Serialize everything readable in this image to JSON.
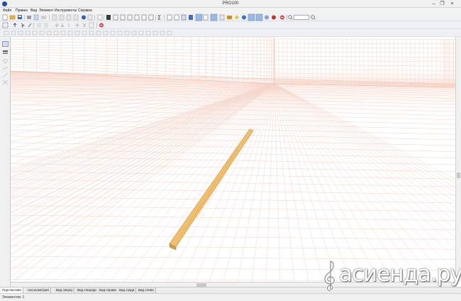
{
  "window": {
    "title": "PRO100"
  },
  "menu": [
    "Файл",
    "Правка",
    "Вид",
    "Элемент",
    "Инструменты",
    "Справка"
  ],
  "view_tabs": [
    {
      "label": "Перспектива",
      "active": true
    },
    {
      "label": "Аксонометрия",
      "active": false
    },
    {
      "label": "Вид сверху",
      "active": false
    },
    {
      "label": "Вид спереди",
      "active": false
    },
    {
      "label": "Вид справа",
      "active": false
    },
    {
      "label": "Вид сзади",
      "active": false
    },
    {
      "label": "Вид слева",
      "active": false
    }
  ],
  "status": {
    "elements": "Элементов: 1"
  },
  "watermark": {
    "text": "асиенда.ру"
  },
  "colors": {
    "grid": "#f2d2c6",
    "board": "#f0c27a",
    "toolbar": "#eef0f3",
    "active_button": "#9fb8e0"
  },
  "icons": {
    "new": "new-file-icon",
    "open": "open-folder-icon",
    "save": "save-icon",
    "undo": "undo-icon",
    "redo": "redo-icon",
    "sum": "sigma-icon",
    "zoom": "magnifier-icon",
    "stop": "stop-icon"
  }
}
